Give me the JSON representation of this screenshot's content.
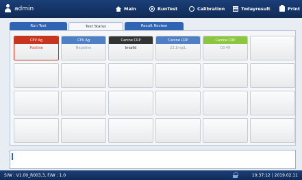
{
  "header": {
    "user": "admin",
    "nav": [
      {
        "label": "Main",
        "icon": "home-icon"
      },
      {
        "label": "RunTest",
        "icon": "run-icon"
      },
      {
        "label": "Calibration",
        "icon": "calibration-icon"
      },
      {
        "label": "Todayresult",
        "icon": "today-result-icon"
      },
      {
        "label": "Print",
        "icon": "print-icon"
      }
    ]
  },
  "tabs": [
    {
      "label": "Run Test",
      "active": false
    },
    {
      "label": "Test Status",
      "active": true
    },
    {
      "label": "Result Review",
      "active": false
    }
  ],
  "test_cells": [
    {
      "title": "CPV Ag",
      "value": "Positive",
      "header_color": "#c8351f",
      "value_color": "#c8351f"
    },
    {
      "title": "CPV Ag",
      "value": "Negative",
      "header_color": "#4f7fc4",
      "value_color": "#8a98ad"
    },
    {
      "title": "Canine CRP",
      "value": "Invalid",
      "header_color": "#333333",
      "value_color": "#222222"
    },
    {
      "title": "Canine CRP",
      "value": "23.1mg/L",
      "header_color": "#4f7fc4",
      "value_color": "#8a98ad"
    },
    {
      "title": "Canine CRP",
      "value": "03:49",
      "header_color": "#8cc63f",
      "value_color": "#8a98ad"
    }
  ],
  "footer": {
    "firmware": "S/W : V1.00_R003.3, F/W : 1.0",
    "datetime": "10:37:12 | 2019.02.11"
  },
  "colors": {
    "topbar": "#1c3f78",
    "tab": "#2f64b5"
  }
}
